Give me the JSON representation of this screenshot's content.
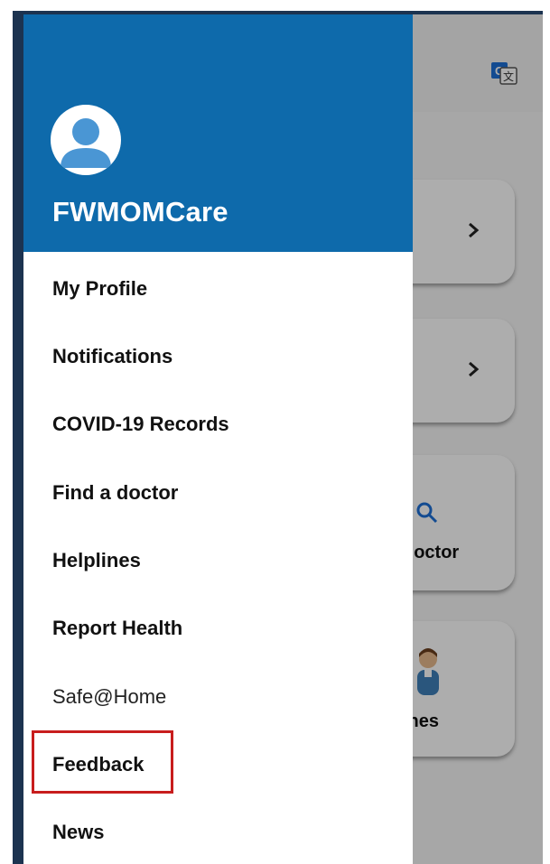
{
  "drawer": {
    "app_name": "FWMOMCare",
    "menu_items": [
      {
        "label": "My Profile"
      },
      {
        "label": "Notifications"
      },
      {
        "label": "COVID-19 Records"
      },
      {
        "label": "Find a doctor"
      },
      {
        "label": "Helplines"
      },
      {
        "label": "Report Health"
      },
      {
        "label": "Safe@Home"
      },
      {
        "label": "Feedback"
      },
      {
        "label": "News"
      }
    ]
  },
  "background": {
    "card_find_doctor_label": "doctor",
    "card_helplines_label": "ines",
    "icons": [
      "translate-icon",
      "chevron-right-icon",
      "search-icon",
      "helpline-person-icon"
    ]
  },
  "highlight": {
    "target": "Feedback",
    "color": "#c81d1d"
  },
  "colors": {
    "header_blue": "#0e6aab",
    "frame_navy": "#1c3350",
    "avatar_blue": "#4a96d4"
  }
}
